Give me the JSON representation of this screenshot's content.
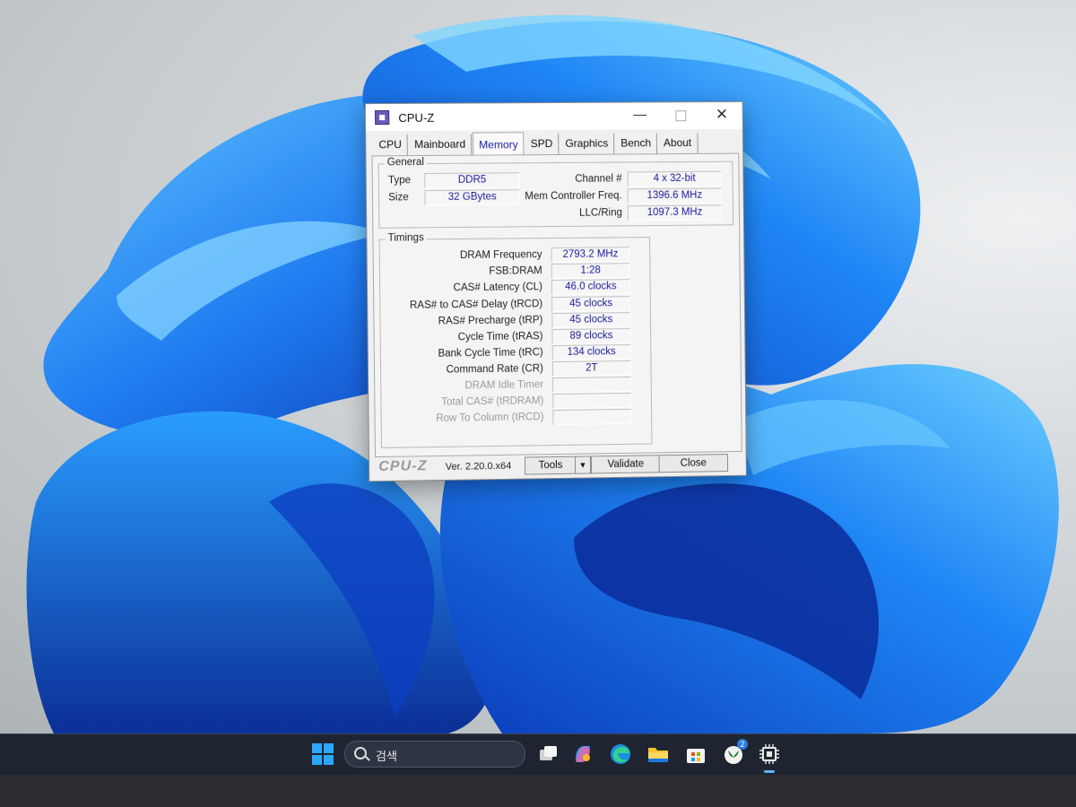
{
  "window": {
    "title": "CPU-Z",
    "minimize": "—",
    "close": "✕"
  },
  "tabs": [
    {
      "label": "CPU",
      "active": false
    },
    {
      "label": "Mainboard",
      "active": false
    },
    {
      "label": "Memory",
      "active": true
    },
    {
      "label": "SPD",
      "active": false
    },
    {
      "label": "Graphics",
      "active": false
    },
    {
      "label": "Bench",
      "active": false
    },
    {
      "label": "About",
      "active": false
    }
  ],
  "general": {
    "title": "General",
    "type_label": "Type",
    "type_value": "DDR5",
    "size_label": "Size",
    "size_value": "32 GBytes",
    "channel_label": "Channel #",
    "channel_value": "4 x 32-bit",
    "mem_ctrl_label": "Mem Controller Freq.",
    "mem_ctrl_value": "1396.6 MHz",
    "llc_label": "LLC/Ring",
    "llc_value": "1097.3 MHz"
  },
  "timings": {
    "title": "Timings",
    "rows": [
      {
        "label": "DRAM Frequency",
        "value": "2793.2 MHz",
        "enabled": true
      },
      {
        "label": "FSB:DRAM",
        "value": "1:28",
        "enabled": true
      },
      {
        "label": "CAS# Latency (CL)",
        "value": "46.0 clocks",
        "enabled": true
      },
      {
        "label": "RAS# to CAS# Delay (tRCD)",
        "value": "45 clocks",
        "enabled": true
      },
      {
        "label": "RAS# Precharge (tRP)",
        "value": "45 clocks",
        "enabled": true
      },
      {
        "label": "Cycle Time (tRAS)",
        "value": "89 clocks",
        "enabled": true
      },
      {
        "label": "Bank Cycle Time (tRC)",
        "value": "134 clocks",
        "enabled": true
      },
      {
        "label": "Command Rate (CR)",
        "value": "2T",
        "enabled": true
      },
      {
        "label": "DRAM Idle Timer",
        "value": "",
        "enabled": false
      },
      {
        "label": "Total CAS# (tRDRAM)",
        "value": "",
        "enabled": false
      },
      {
        "label": "Row To Column (tRCD)",
        "value": "",
        "enabled": false
      }
    ]
  },
  "footer": {
    "brand": "CPU-Z",
    "version": "Ver. 2.20.0.x64",
    "tools_label": "Tools",
    "tools_arrow": "▼",
    "validate_label": "Validate",
    "close_label": "Close"
  },
  "taskbar": {
    "search_text": "검색",
    "icons": [
      "windows-start-icon",
      "task-view-icon",
      "copilot-icon",
      "edge-icon",
      "file-explorer-icon",
      "microsoft-store-icon",
      "xbox-icon",
      "cpu-z-taskbar-icon"
    ],
    "xbox_badge": "2",
    "colors": {
      "taskbar_bg": "#1e2530",
      "accent": "#2aa7ff"
    }
  }
}
